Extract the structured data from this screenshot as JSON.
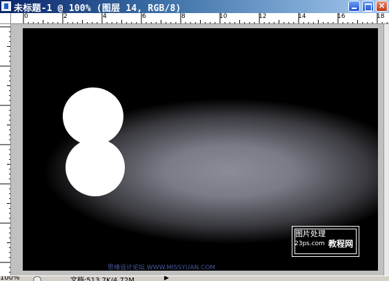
{
  "window": {
    "title": "未标题-1 @ 100% (图层 14, RGB/8)",
    "close_glyph": "×"
  },
  "ruler": {
    "horizontal": [
      "0",
      "2",
      "4",
      "6",
      "8",
      "10",
      "12",
      "14",
      "16",
      "18"
    ]
  },
  "canvas": {
    "logo_line1": "图片处理",
    "logo_line2": "23ps.com",
    "logo_line3": "教程网",
    "watermark": "思缘设计论坛 WWW.MISSYUAN.COM"
  },
  "statusbar": {
    "zoom": "100%",
    "doc_info": "文档:513.7K/4.72M",
    "arrow": "▶"
  },
  "colors": {
    "titlebar_start": "#0a246a",
    "titlebar_end": "#a6caf0",
    "canvas_glow": "#8b8c98",
    "workspace": "#c0c0c0"
  }
}
